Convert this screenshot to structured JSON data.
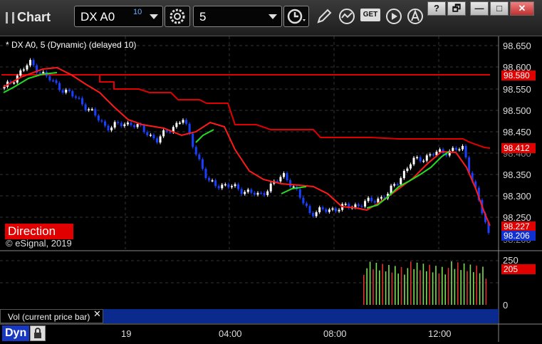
{
  "toolbar": {
    "app_title": "Chart",
    "symbol": "DX A0",
    "symbol_link_badge": "10",
    "interval": "5",
    "get_label": "GET"
  },
  "window": {
    "help": "?",
    "restore": "🗗",
    "minimize": "—",
    "maximize": "□",
    "close": "✕"
  },
  "chart": {
    "legend": "* DX A0, 5 (Dynamic) (delayed 10)",
    "direction_label": "Direction",
    "copyright": "© eSignal, 2019",
    "price_ticks": [
      "98.650",
      "98.600",
      "98.550",
      "98.500",
      "98.450",
      "98.400",
      "98.350",
      "98.300",
      "98.250",
      "98.200"
    ],
    "price_tags": [
      {
        "label": "98.580",
        "color": "#e00000"
      },
      {
        "label": "98.412",
        "color": "#e00000"
      },
      {
        "label": "98.227",
        "color": "#e00000"
      },
      {
        "label": "98.206",
        "color": "#1030d0"
      }
    ],
    "x_ticks": [
      "19",
      "04:00",
      "08:00",
      "12:00"
    ],
    "volume": {
      "label": "Vol (current price bar)",
      "close": "✕",
      "ticks": [
        "250",
        "0"
      ],
      "current": "205"
    },
    "mode": "Dyn",
    "colors": {
      "up": "#ffffff",
      "down": "#1a40ff",
      "ma_fast": "#ff1a1a",
      "ma_slow": "#22dd22",
      "resistance": "#e00000"
    }
  },
  "chart_data": {
    "type": "line",
    "title": "DX A0, 5 (Dynamic) (delayed 10)",
    "x": [
      "19",
      "04:00",
      "08:00",
      "12:00"
    ],
    "ylim": [
      98.2,
      98.65
    ],
    "series": [
      {
        "name": "price",
        "values": [
          98.55,
          98.61,
          98.56,
          98.52,
          98.46,
          98.47,
          98.43,
          98.48,
          98.33,
          98.32,
          98.3,
          98.35,
          98.26,
          98.27,
          98.28,
          98.3,
          98.38,
          98.4,
          98.41,
          98.21
        ]
      },
      {
        "name": "volume",
        "values": [
          205
        ]
      }
    ]
  }
}
